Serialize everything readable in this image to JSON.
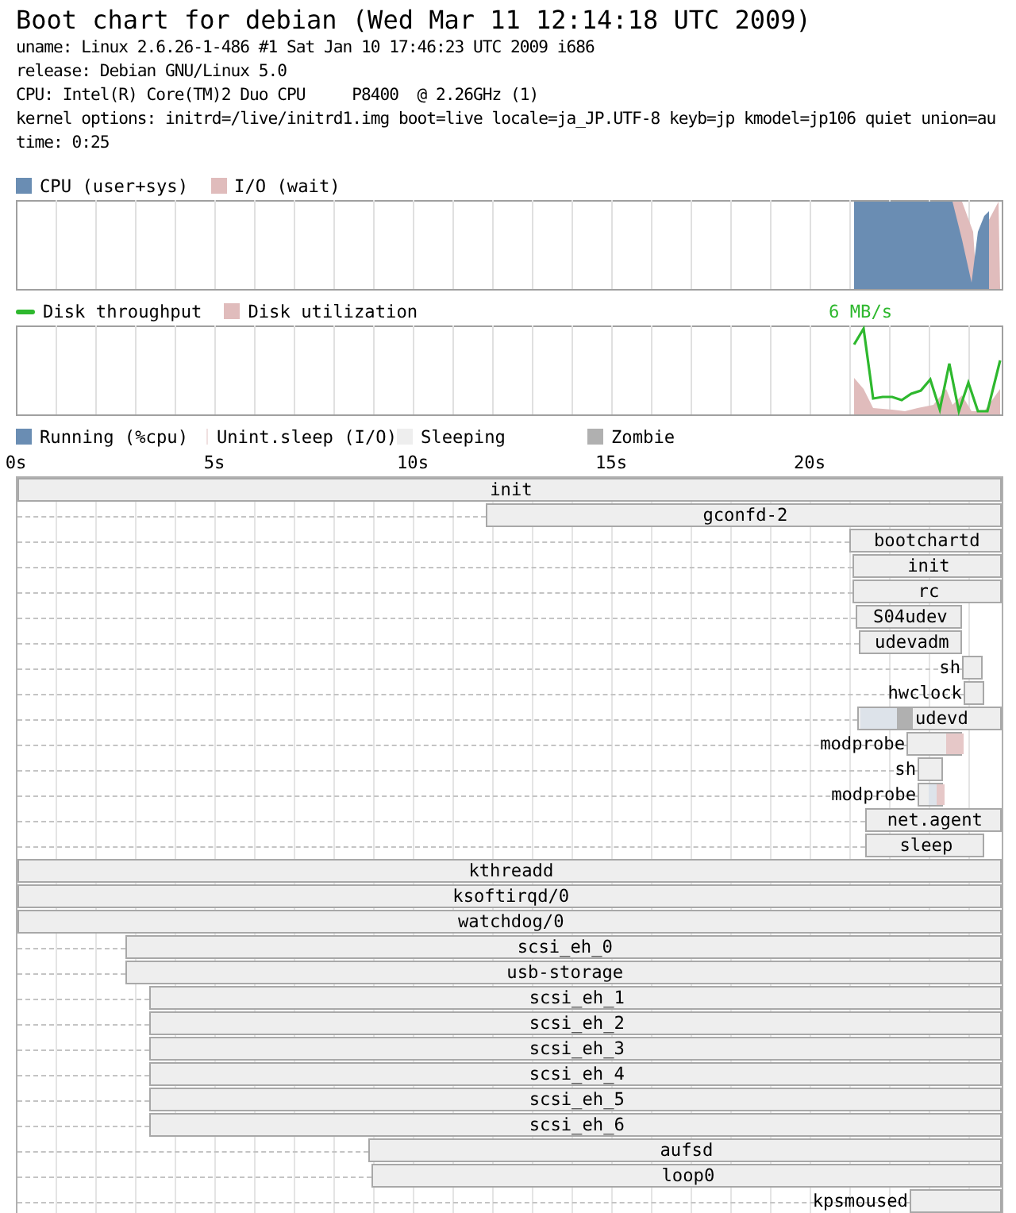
{
  "title": "Boot chart for debian (Wed Mar 11 12:14:18 UTC 2009)",
  "info_lines": [
    "uname: Linux 2.6.26-1-486 #1 Sat Jan 10 17:46:23 UTC 2009 i686",
    "release: Debian GNU/Linux 5.0",
    "CPU: Intel(R) Core(TM)2 Duo CPU     P8400  @ 2.26GHz (1)",
    "kernel options: initrd=/live/initrd1.img boot=live locale=ja_JP.UTF-8 keyb=jp kmodel=jp106 quiet union=au",
    "time: 0:25"
  ],
  "cpu_legend": [
    {
      "label": "CPU (user+sys)",
      "kind": "box",
      "color": "#6a8db3"
    },
    {
      "label": "I/O (wait)",
      "kind": "box",
      "color": "#e0bcbc"
    }
  ],
  "disk_legend": [
    {
      "label": "Disk throughput",
      "kind": "line",
      "color": "#2eb82e"
    },
    {
      "label": "Disk utilization",
      "kind": "box",
      "color": "#e0bcbc"
    }
  ],
  "disk_peak_label": "6 MB/s",
  "process_legend": [
    {
      "label": "Running (%cpu)",
      "kind": "box",
      "color": "#6a8db3"
    },
    {
      "label": "Unint.sleep (I/O)",
      "kind": "box",
      "color": "#f0e0e0"
    },
    {
      "label": "Sleeping",
      "kind": "box",
      "color": "#eeeeee"
    },
    {
      "label": "Zombie",
      "kind": "box",
      "color": "#b0b0b0"
    }
  ],
  "time_axis": [
    "0s",
    "5s",
    "10s",
    "15s",
    "20s"
  ],
  "processes": [
    {
      "name": "init"
    },
    {
      "name": "gconfd-2"
    },
    {
      "name": "bootchartd"
    },
    {
      "name": "init"
    },
    {
      "name": "rc"
    },
    {
      "name": "S04udev"
    },
    {
      "name": "udevadm"
    },
    {
      "name": "sh"
    },
    {
      "name": "hwclock"
    },
    {
      "name": "udevd",
      "segments": [
        {
          "kind": "running"
        },
        {
          "kind": "zombie"
        }
      ]
    },
    {
      "name": "modprobe",
      "segments": [
        {
          "kind": "iowait"
        }
      ]
    },
    {
      "name": "sh"
    },
    {
      "name": "modprobe",
      "segments": [
        {
          "kind": "running"
        },
        {
          "kind": "iowait"
        }
      ]
    },
    {
      "name": "net.agent"
    },
    {
      "name": "sleep"
    },
    {
      "name": "kthreadd"
    },
    {
      "name": "ksoftirqd/0"
    },
    {
      "name": "watchdog/0"
    },
    {
      "name": "scsi_eh_0"
    },
    {
      "name": "usb-storage"
    },
    {
      "name": "scsi_eh_1"
    },
    {
      "name": "scsi_eh_2"
    },
    {
      "name": "scsi_eh_3"
    },
    {
      "name": "scsi_eh_4"
    },
    {
      "name": "scsi_eh_5"
    },
    {
      "name": "scsi_eh_6"
    },
    {
      "name": "aufsd"
    },
    {
      "name": "loop0"
    },
    {
      "name": "kpsmoused"
    }
  ]
}
